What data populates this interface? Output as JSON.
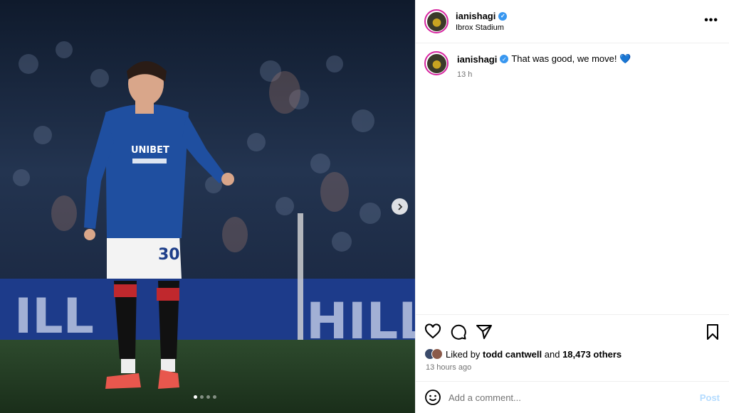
{
  "post": {
    "username": "ianishagi",
    "location": "Ibrox Stadium",
    "caption": {
      "username": "ianishagi",
      "text": "That was good, we move! 💙",
      "time": "13 h"
    },
    "likes": {
      "prefix": "Liked by",
      "user": "todd cantwell",
      "joiner": "and",
      "others": "18,473 others"
    },
    "time_ago": "13 hours ago",
    "comment": {
      "placeholder": "Add a comment...",
      "post_label": "Post"
    }
  },
  "media": {
    "jersey_sponsor": "UNIBET",
    "shirt_number": "30",
    "board_text": "HILL",
    "carousel": {
      "count": 4,
      "active": 1
    }
  },
  "icons": {
    "more": "more-options-icon",
    "like": "heart-icon",
    "comment": "comment-icon",
    "share": "share-icon",
    "save": "bookmark-icon",
    "emoji": "emoji-icon",
    "next": "chevron-right-icon",
    "verified": "verified-badge-icon"
  },
  "colors": {
    "verified": "#3897f0",
    "post_disabled": "#b3dbff",
    "jersey": "#1f4fa0"
  }
}
